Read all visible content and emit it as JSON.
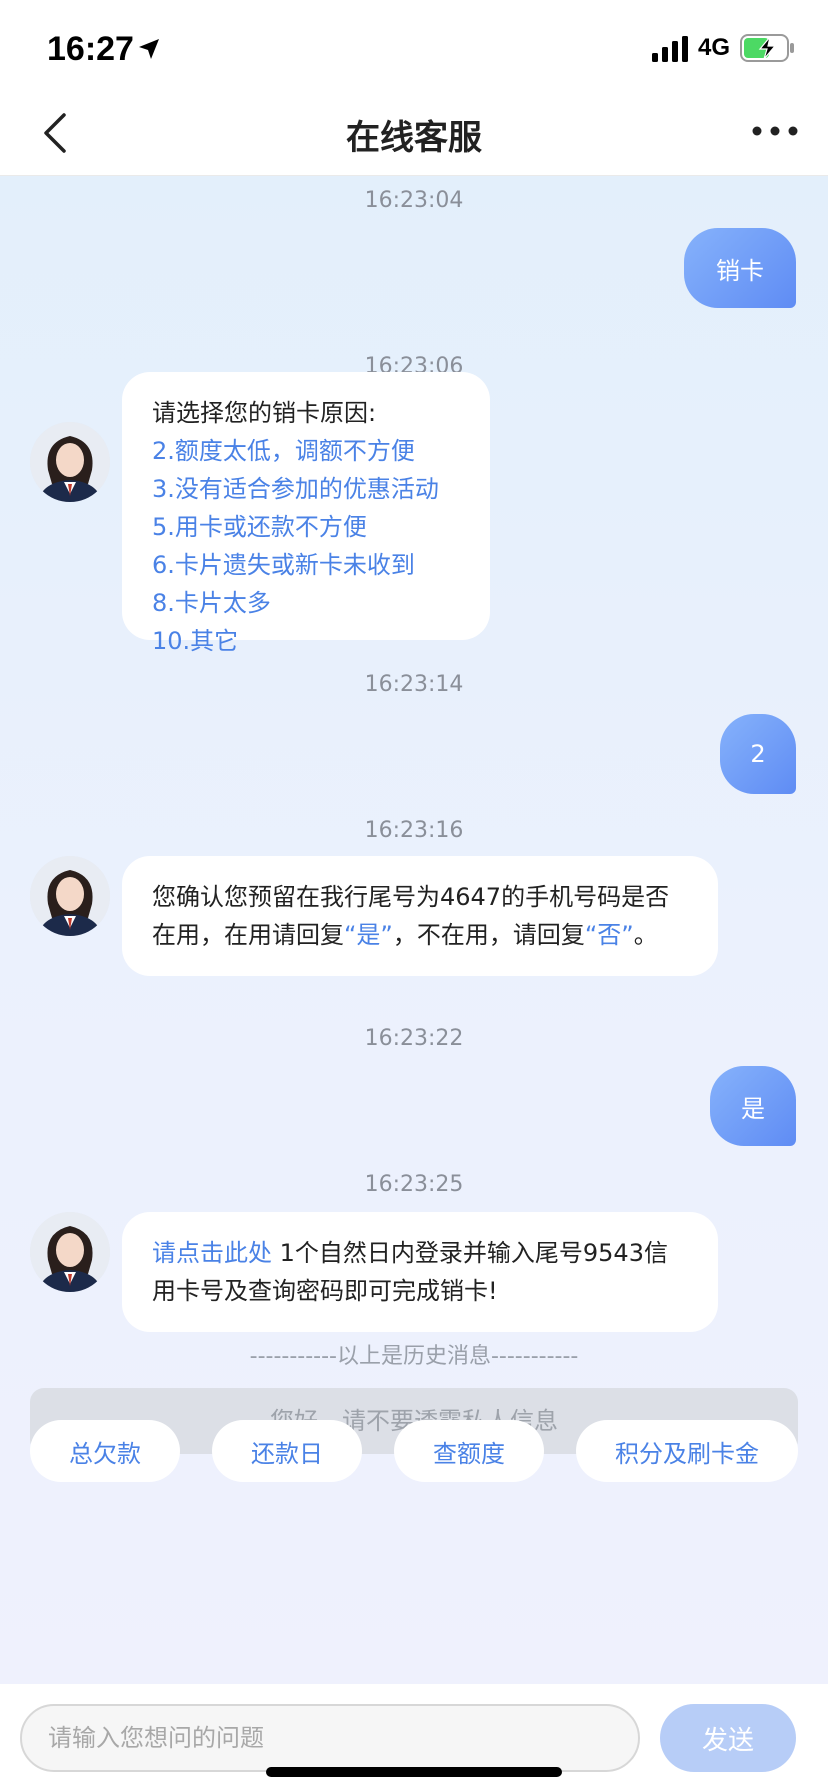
{
  "status_bar": {
    "time": "16:27",
    "network": "4G"
  },
  "nav": {
    "title": "在线客服"
  },
  "messages": [
    {
      "timestamp": "16:23:04",
      "from": "user",
      "text": "销卡"
    },
    {
      "timestamp": "16:23:06",
      "from": "agent",
      "prompt": "请选择您的销卡原因:",
      "options": [
        "2.额度太低，调额不方便",
        "3.没有适合参加的优惠活动",
        "5.用卡或还款不方便",
        "6.卡片遗失或新卡未收到",
        "8.卡片太多",
        "10.其它"
      ]
    },
    {
      "timestamp": "16:23:14",
      "from": "user",
      "text": "2"
    },
    {
      "timestamp": "16:23:16",
      "from": "agent",
      "text_part1": "您确认您预留在我行尾号为4647的手机号码是否在用，在用请回复",
      "quote_yes": "“是”",
      "text_part2": "，不在用，请回复",
      "quote_no": "“否”",
      "text_part3": "。"
    },
    {
      "timestamp": "16:23:22",
      "from": "user",
      "text": "是"
    },
    {
      "timestamp": "16:23:25",
      "from": "agent",
      "link_text": "请点击此处",
      "text": " 1个自然日内登录并输入尾号9543信用卡号及查询密码即可完成销卡!"
    }
  ],
  "history_divider": "-----------以上是历史消息-----------",
  "notice": "您好，请不要透露私人信息",
  "quick_actions": [
    "总欠款",
    "还款日",
    "查额度",
    "积分及刷卡金"
  ],
  "input": {
    "placeholder": "请输入您想问的问题",
    "send_label": "发送"
  },
  "colors": {
    "accent": "#4a82e6",
    "user_bubble": "#6f9bf7",
    "send_disabled": "#b7cdf7"
  }
}
